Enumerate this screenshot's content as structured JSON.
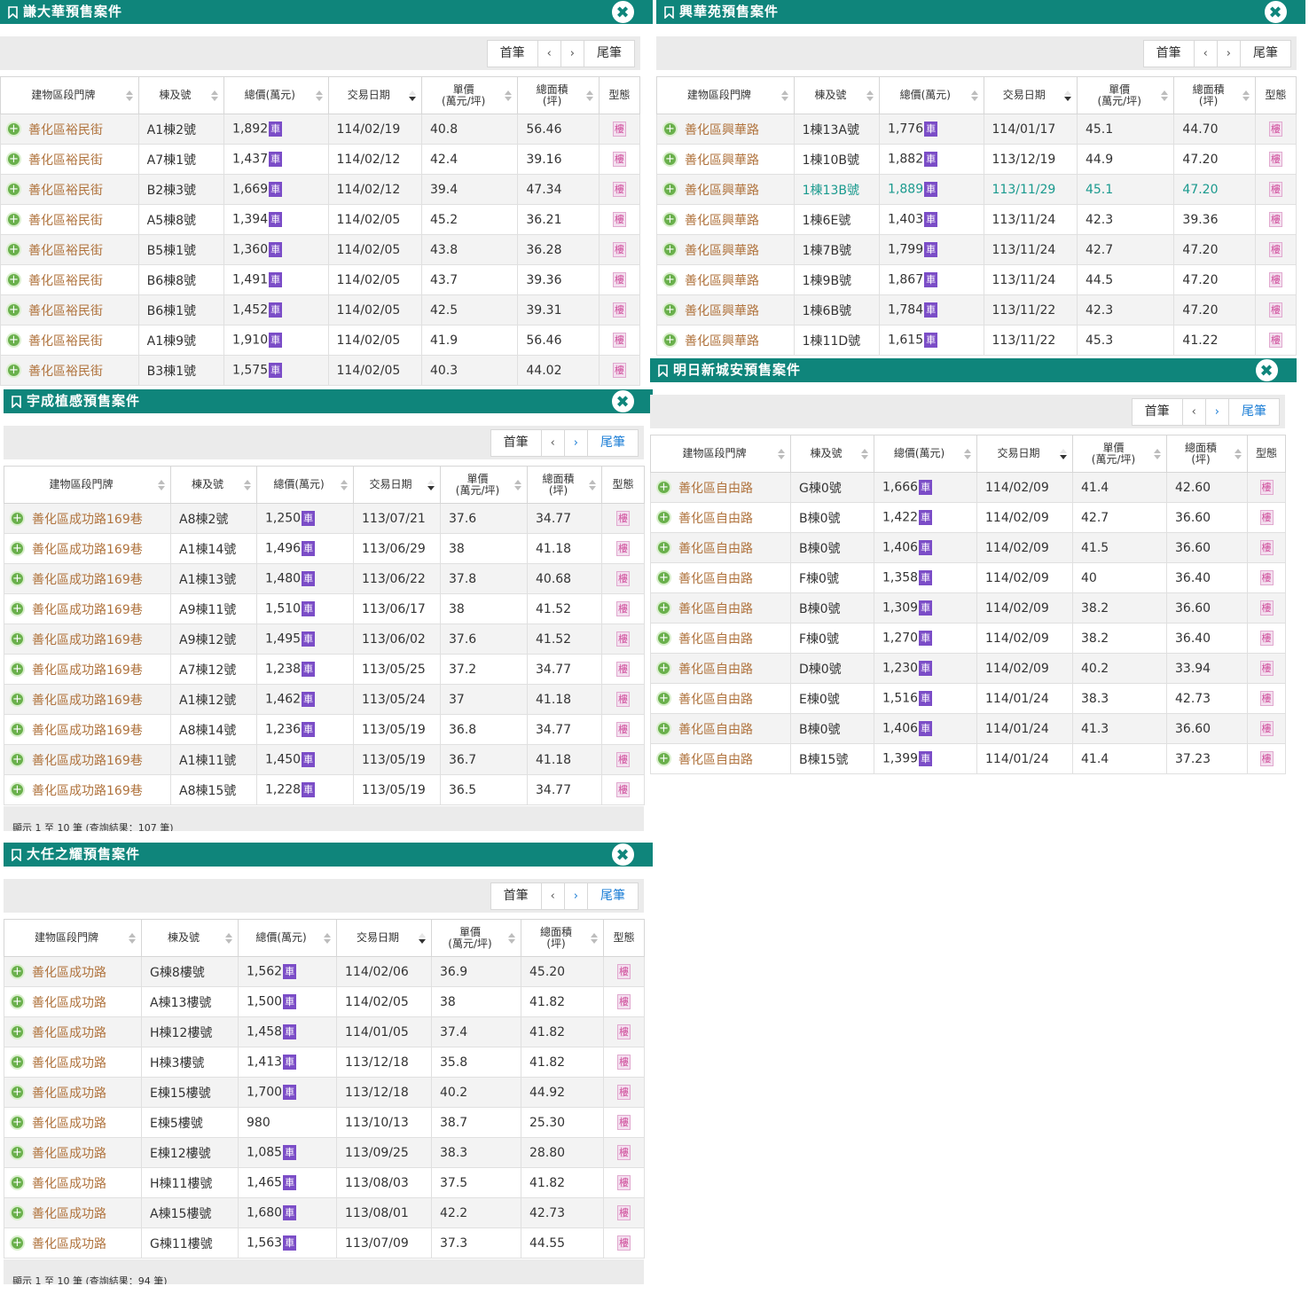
{
  "common": {
    "headers": [
      "建物區段門牌",
      "棟及號",
      "總價(萬元)",
      "交易日期",
      "單價\n(萬元/坪)",
      "總面積\n(坪)",
      "型態"
    ],
    "car_label": "車",
    "type_label": "樓",
    "plus": "+",
    "close": "✖",
    "pager": {
      "first": "首筆",
      "prev": "‹",
      "next": "›",
      "last": "尾筆"
    }
  },
  "panels": [
    {
      "title": "謙大華預售案件",
      "rows": [
        [
          "善化區裕民街",
          "A1棟2號",
          "1,892",
          "114/02/19",
          "40.8",
          "56.46"
        ],
        [
          "善化區裕民街",
          "A7棟1號",
          "1,437",
          "114/02/12",
          "42.4",
          "39.16"
        ],
        [
          "善化區裕民街",
          "B2棟3號",
          "1,669",
          "114/02/12",
          "39.4",
          "47.34"
        ],
        [
          "善化區裕民街",
          "A5棟8號",
          "1,394",
          "114/02/05",
          "45.2",
          "36.21"
        ],
        [
          "善化區裕民街",
          "B5棟1號",
          "1,360",
          "114/02/05",
          "43.8",
          "36.28"
        ],
        [
          "善化區裕民街",
          "B6棟8號",
          "1,491",
          "114/02/05",
          "43.7",
          "39.36"
        ],
        [
          "善化區裕民街",
          "B6棟1號",
          "1,452",
          "114/02/05",
          "42.5",
          "39.31"
        ],
        [
          "善化區裕民街",
          "A1棟9號",
          "1,910",
          "114/02/05",
          "41.9",
          "56.46"
        ],
        [
          "善化區裕民街",
          "B3棟1號",
          "1,575",
          "114/02/05",
          "40.3",
          "44.02"
        ]
      ]
    },
    {
      "title": "興華苑預售案件",
      "rows": [
        [
          "善化區興華路",
          "1棟13A號",
          "1,776",
          "114/01/17",
          "45.1",
          "44.70"
        ],
        [
          "善化區興華路",
          "1棟10B號",
          "1,882",
          "113/12/19",
          "44.9",
          "47.20"
        ],
        [
          "善化區興華路",
          "1棟13B號",
          "1,889",
          "113/11/29",
          "45.1",
          "47.20"
        ],
        [
          "善化區興華路",
          "1棟6E號",
          "1,403",
          "113/11/24",
          "42.3",
          "39.36"
        ],
        [
          "善化區興華路",
          "1棟7B號",
          "1,799",
          "113/11/24",
          "42.7",
          "47.20"
        ],
        [
          "善化區興華路",
          "1棟9B號",
          "1,867",
          "113/11/24",
          "44.5",
          "47.20"
        ],
        [
          "善化區興華路",
          "1棟6B號",
          "1,784",
          "113/11/22",
          "42.3",
          "47.20"
        ],
        [
          "善化區興華路",
          "1棟11D號",
          "1,615",
          "113/11/22",
          "45.3",
          "41.22"
        ]
      ]
    },
    {
      "title": "宇成植感預售案件",
      "footer": "顯示 1 至 10 筆 (查詢結果：107 筆)",
      "rows": [
        [
          "善化區成功路169巷",
          "A8棟2號",
          "1,250",
          "113/07/21",
          "37.6",
          "34.77"
        ],
        [
          "善化區成功路169巷",
          "A1棟14號",
          "1,496",
          "113/06/29",
          "38",
          "41.18"
        ],
        [
          "善化區成功路169巷",
          "A1棟13號",
          "1,480",
          "113/06/22",
          "37.8",
          "40.68"
        ],
        [
          "善化區成功路169巷",
          "A9棟11號",
          "1,510",
          "113/06/17",
          "38",
          "41.52"
        ],
        [
          "善化區成功路169巷",
          "A9棟12號",
          "1,495",
          "113/06/02",
          "37.6",
          "41.52"
        ],
        [
          "善化區成功路169巷",
          "A7棟12號",
          "1,238",
          "113/05/25",
          "37.2",
          "34.77"
        ],
        [
          "善化區成功路169巷",
          "A1棟12號",
          "1,462",
          "113/05/24",
          "37",
          "41.18"
        ],
        [
          "善化區成功路169巷",
          "A8棟14號",
          "1,236",
          "113/05/19",
          "36.8",
          "34.77"
        ],
        [
          "善化區成功路169巷",
          "A1棟11號",
          "1,450",
          "113/05/19",
          "36.7",
          "41.18"
        ],
        [
          "善化區成功路169巷",
          "A8棟15號",
          "1,228",
          "113/05/19",
          "36.5",
          "34.77"
        ]
      ]
    },
    {
      "title": "明日新城安預售案件",
      "rows": [
        [
          "善化區自由路",
          "G棟0號",
          "1,666",
          "114/02/09",
          "41.4",
          "42.60"
        ],
        [
          "善化區自由路",
          "B棟0號",
          "1,422",
          "114/02/09",
          "42.7",
          "36.60"
        ],
        [
          "善化區自由路",
          "B棟0號",
          "1,406",
          "114/02/09",
          "41.5",
          "36.60"
        ],
        [
          "善化區自由路",
          "F棟0號",
          "1,358",
          "114/02/09",
          "40",
          "36.40"
        ],
        [
          "善化區自由路",
          "B棟0號",
          "1,309",
          "114/02/09",
          "38.2",
          "36.60"
        ],
        [
          "善化區自由路",
          "F棟0號",
          "1,270",
          "114/02/09",
          "38.2",
          "36.40"
        ],
        [
          "善化區自由路",
          "D棟0號",
          "1,230",
          "114/02/09",
          "40.2",
          "33.94"
        ],
        [
          "善化區自由路",
          "E棟0號",
          "1,516",
          "114/01/24",
          "38.3",
          "42.73"
        ],
        [
          "善化區自由路",
          "B棟0號",
          "1,406",
          "114/01/24",
          "41.3",
          "36.60"
        ],
        [
          "善化區自由路",
          "B棟15號",
          "1,399",
          "114/01/24",
          "41.4",
          "37.23"
        ]
      ]
    },
    {
      "title": "大任之耀預售案件",
      "footer": "顯示 1 至 10 筆 (查詢結果：94 筆)",
      "rows": [
        [
          "善化區成功路",
          "G棟8樓號",
          "1,562",
          "114/02/06",
          "36.9",
          "45.20"
        ],
        [
          "善化區成功路",
          "A棟13樓號",
          "1,500",
          "114/02/05",
          "38",
          "41.82"
        ],
        [
          "善化區成功路",
          "H棟12樓號",
          "1,458",
          "114/01/05",
          "37.4",
          "41.82"
        ],
        [
          "善化區成功路",
          "H棟3樓號",
          "1,413",
          "113/12/18",
          "35.8",
          "41.82"
        ],
        [
          "善化區成功路",
          "E棟15樓號",
          "1,700",
          "113/12/18",
          "40.2",
          "44.92"
        ],
        [
          "善化區成功路",
          "E棟5樓號",
          "980",
          "113/10/13",
          "38.7",
          "25.30"
        ],
        [
          "善化區成功路",
          "E棟12樓號",
          "1,085",
          "113/09/25",
          "38.3",
          "28.80"
        ],
        [
          "善化區成功路",
          "H棟11樓號",
          "1,465",
          "113/08/03",
          "37.5",
          "41.82"
        ],
        [
          "善化區成功路",
          "A棟15樓號",
          "1,680",
          "113/08/01",
          "42.2",
          "42.73"
        ],
        [
          "善化區成功路",
          "G棟11樓號",
          "1,563",
          "113/07/09",
          "37.3",
          "44.55"
        ]
      ]
    }
  ]
}
